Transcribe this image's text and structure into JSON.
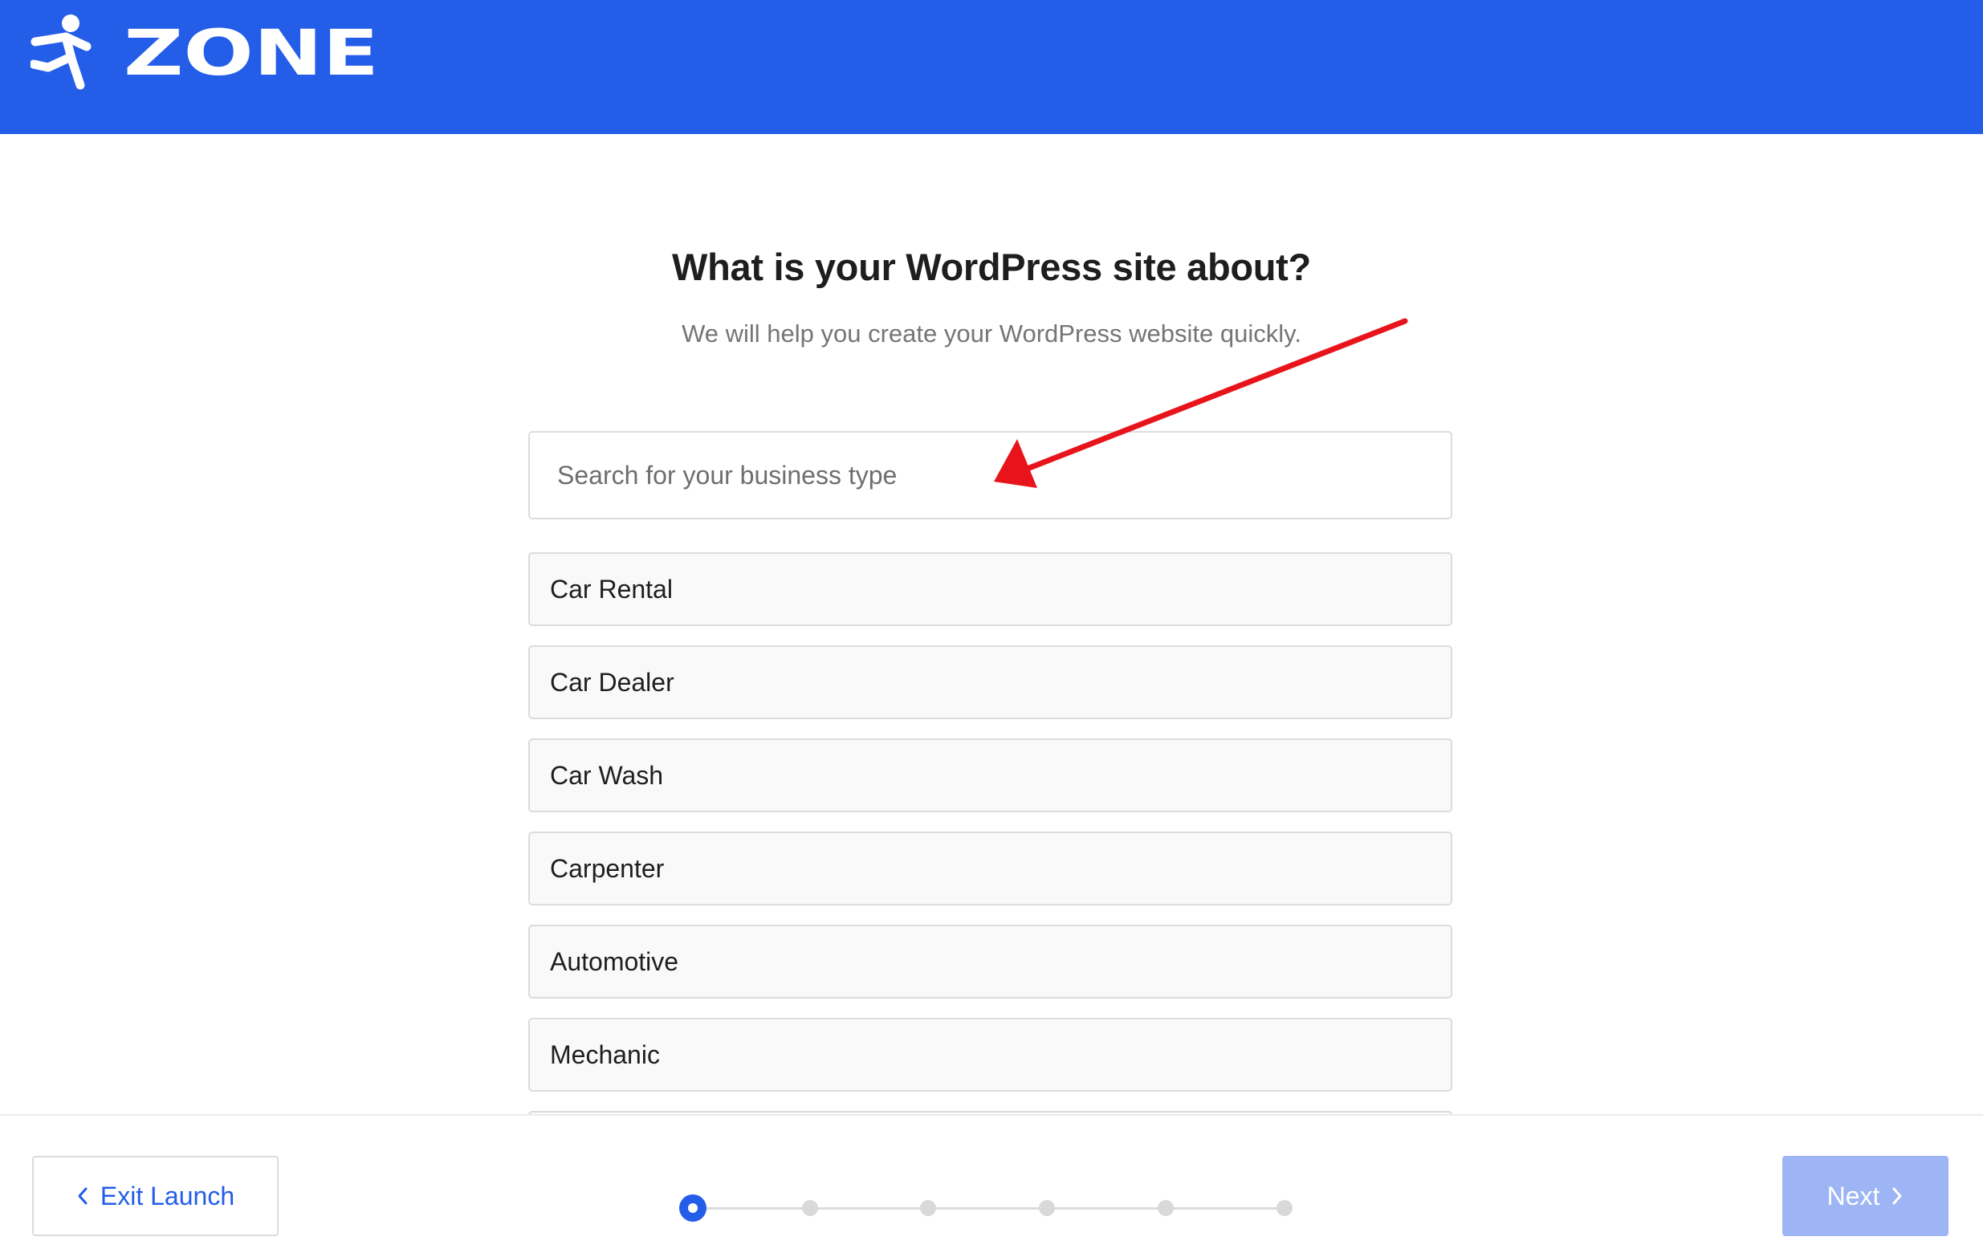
{
  "header": {
    "brand": "ZONE",
    "background_color": "#235de8",
    "icons": {
      "logo": "running-person-icon"
    }
  },
  "main": {
    "title": "What is your WordPress site about?",
    "subtitle": "We will help you create your WordPress website quickly.",
    "search": {
      "placeholder": "Search for your business type",
      "value": ""
    },
    "business_types": [
      "Car Rental",
      "Car Dealer",
      "Car Wash",
      "Carpenter",
      "Automotive",
      "Mechanic",
      ""
    ]
  },
  "footer": {
    "exit_label": "Exit Launch",
    "next_label": "Next",
    "progress": {
      "total_steps": 6,
      "current_step": 1
    },
    "colors": {
      "accent": "#235de8",
      "next_disabled": "#9db5f5"
    },
    "icons": {
      "back": "chevron-left-icon",
      "forward": "chevron-right-icon"
    }
  },
  "annotation": {
    "color": "#e8141b",
    "icon": "red-arrow-icon"
  }
}
